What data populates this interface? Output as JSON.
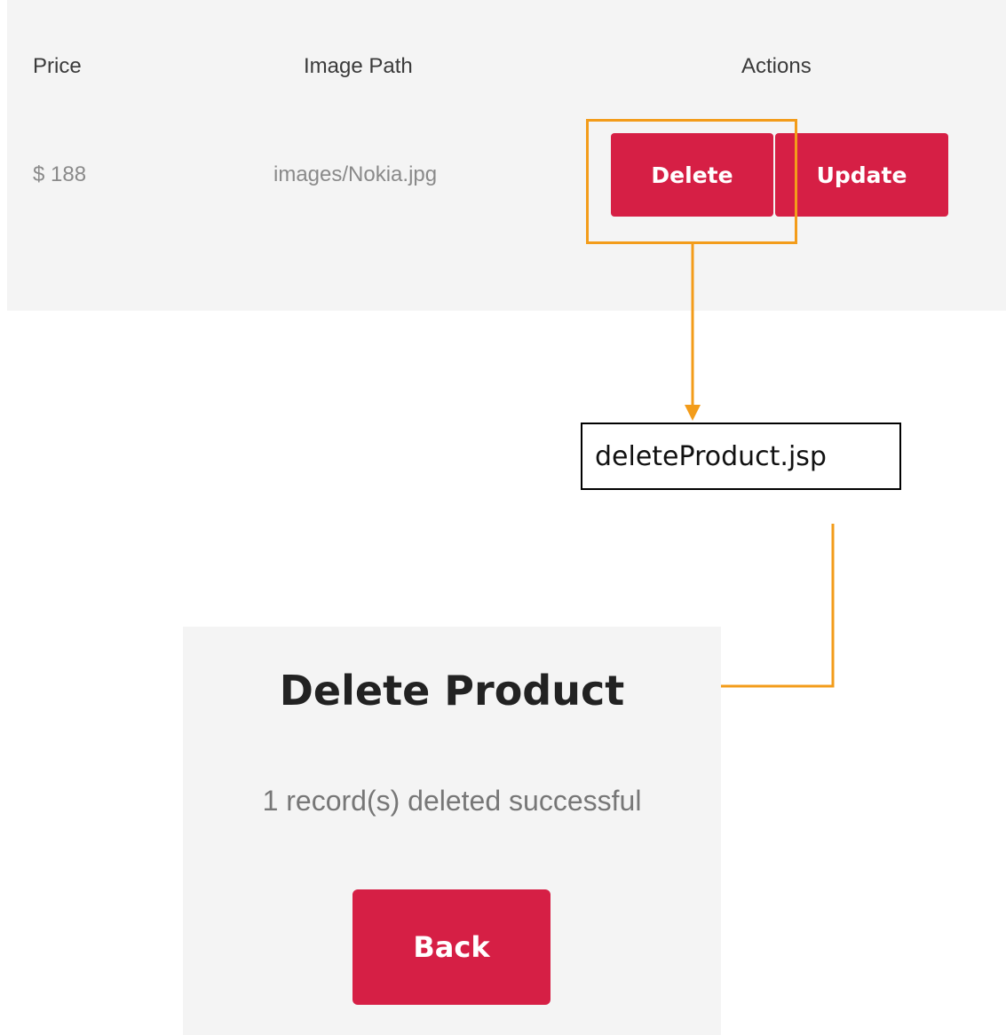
{
  "table": {
    "headers": {
      "price": "Price",
      "image_path": "Image Path",
      "actions": "Actions"
    },
    "row": {
      "price": "$ 188",
      "image_path": "images/Nokia.jpg"
    },
    "buttons": {
      "delete": "Delete",
      "update": "Update"
    }
  },
  "flow": {
    "file_label": "deleteProduct.jsp"
  },
  "result": {
    "title": "Delete Product",
    "message": "1 record(s) deleted successful",
    "back_label": "Back"
  },
  "colors": {
    "button": "#d61f45",
    "annotation": "#f39c1a",
    "panel": "#f4f4f4"
  }
}
